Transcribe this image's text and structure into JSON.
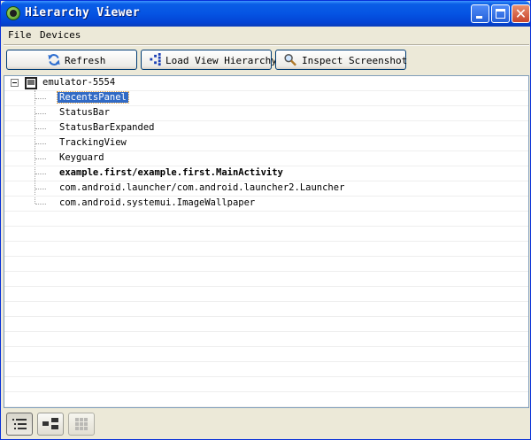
{
  "window": {
    "title": "Hierarchy Viewer",
    "icon": "hierarchy-viewer-app-icon",
    "controls": {
      "minimize": "minimize-icon",
      "maximize": "maximize-icon",
      "close": "✕"
    }
  },
  "menu": {
    "file": "File",
    "devices": "Devices"
  },
  "toolbar": {
    "refresh": {
      "label": "Refresh",
      "icon": "refresh-icon"
    },
    "load": {
      "label": "Load View Hierarchy",
      "icon": "hierarchy-icon"
    },
    "inspect": {
      "label": "Inspect Screenshot",
      "icon": "magnifier-icon"
    }
  },
  "tree": {
    "device": {
      "label": "emulator-5554",
      "expanded": true,
      "icon": "device-icon"
    },
    "windows": [
      {
        "label": "RecentsPanel",
        "selected": true,
        "bold": false
      },
      {
        "label": "StatusBar",
        "selected": false,
        "bold": false
      },
      {
        "label": "StatusBarExpanded",
        "selected": false,
        "bold": false
      },
      {
        "label": "TrackingView",
        "selected": false,
        "bold": false
      },
      {
        "label": "Keyguard",
        "selected": false,
        "bold": false
      },
      {
        "label": "example.first/example.first.MainActivity",
        "selected": false,
        "bold": true
      },
      {
        "label": "com.android.launcher/com.android.launcher2.Launcher",
        "selected": false,
        "bold": false
      },
      {
        "label": "com.android.systemui.ImageWallpaper",
        "selected": false,
        "bold": false
      }
    ]
  },
  "status": {
    "views": [
      {
        "name": "tree-list-view-icon",
        "active": true
      },
      {
        "name": "layout-view-icon",
        "active": false
      },
      {
        "name": "pixel-grid-view-icon",
        "active": false
      }
    ]
  },
  "colors": {
    "selection": "#316ac5",
    "titlebar": "#0554e3",
    "chrome": "#ece9d8"
  }
}
